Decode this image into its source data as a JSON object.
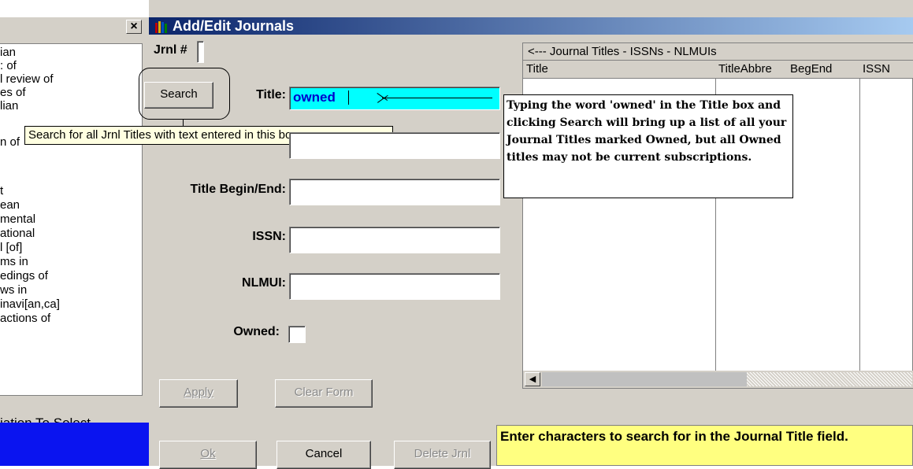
{
  "background_list": {
    "close_glyph": "×",
    "items": [
      "ian",
      ": of",
      "l review of",
      "es of",
      "lian",
      "",
      "n of",
      "",
      "t",
      "ean",
      "mental",
      "ational",
      "l [of]",
      "ms in",
      "edings of",
      "ws in",
      "inavi[an,ca]",
      "actions of"
    ],
    "select_text": "iation To Select"
  },
  "window": {
    "title": "Add/Edit Journals",
    "title_icon": "books-icon"
  },
  "form": {
    "jrnl_label": "Jrnl #",
    "search_label": "Search",
    "title_label": "Title:",
    "title_value": "owned",
    "title_begin_end_label": "Title Begin/End:",
    "issn_label": "ISSN:",
    "nlmui_label": "NLMUI:",
    "owned_label": "Owned:"
  },
  "tooltip": "Search for all Jrnl Titles with text entered in this box.",
  "callout": "Typing the word 'owned' in the Title box and clicking Search will bring up a list of all your Journal Titles marked Owned, but all Owned titles may not be current subscriptions.",
  "grid": {
    "caption": "<---  Journal Titles - ISSNs - NLMUIs",
    "columns": [
      "Title",
      "TitleAbbre",
      "BegEnd",
      "ISSN"
    ],
    "scroll_left_glyph": "◀"
  },
  "buttons": {
    "apply": "Apply",
    "clear_form": "Clear Form",
    "ok": "Ok",
    "cancel": "Cancel",
    "delete_jrnl": "Delete Jrnl"
  },
  "status_help": "Enter characters to search for in the Journal Title field.",
  "colors": {
    "title_field_bg": "#00ffff",
    "status_help_bg": "#ffff80",
    "tooltip_bg": "#ffffe1",
    "titlebar_start": "#0a246a"
  }
}
